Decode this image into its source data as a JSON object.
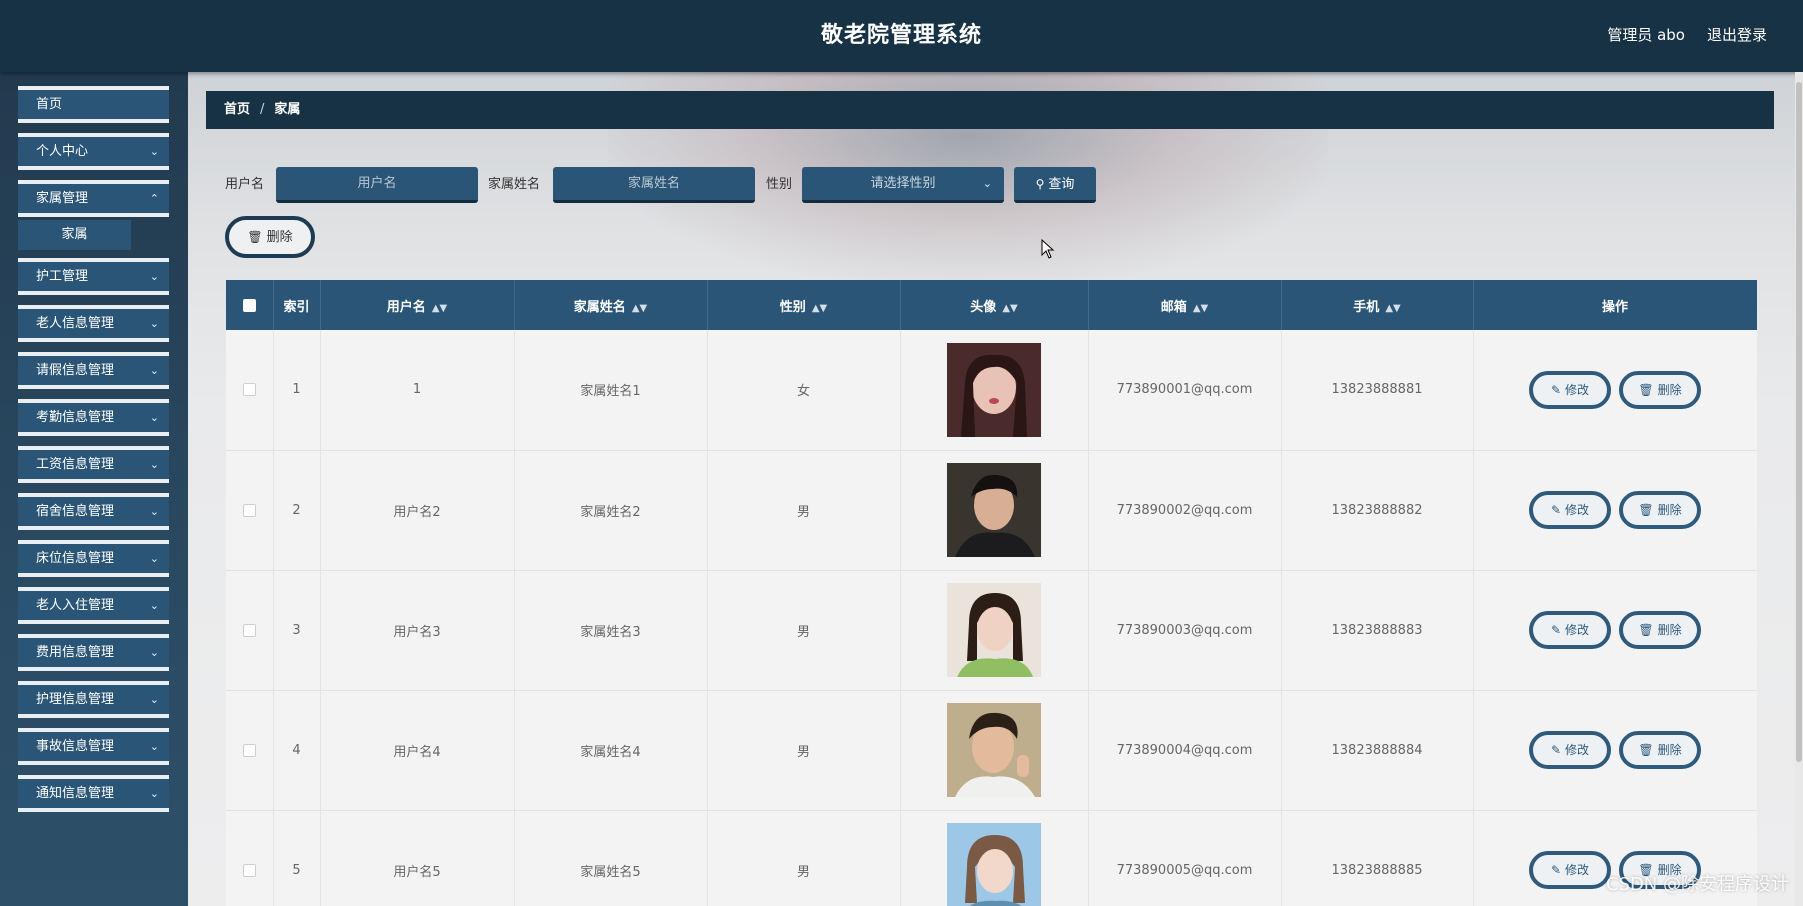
{
  "header": {
    "title": "敬老院管理系统",
    "user": "管理员 abo",
    "logout": "退出登录"
  },
  "sidebar": {
    "items": [
      {
        "label": "首页",
        "has_chevron": false
      },
      {
        "label": "个人中心",
        "has_chevron": true
      },
      {
        "label": "家属管理",
        "has_chevron": true
      },
      {
        "label": "护工管理",
        "has_chevron": true
      },
      {
        "label": "老人信息管理",
        "has_chevron": true
      },
      {
        "label": "请假信息管理",
        "has_chevron": true
      },
      {
        "label": "考勤信息管理",
        "has_chevron": true
      },
      {
        "label": "工资信息管理",
        "has_chevron": true
      },
      {
        "label": "宿舍信息管理",
        "has_chevron": true
      },
      {
        "label": "床位信息管理",
        "has_chevron": true
      },
      {
        "label": "老人入住管理",
        "has_chevron": true
      },
      {
        "label": "费用信息管理",
        "has_chevron": true
      },
      {
        "label": "护理信息管理",
        "has_chevron": true
      },
      {
        "label": "事故信息管理",
        "has_chevron": true
      },
      {
        "label": "通知信息管理",
        "has_chevron": true
      }
    ],
    "submenu_label": "家属"
  },
  "breadcrumb": {
    "home": "首页",
    "separator": "/",
    "current": "家属"
  },
  "search": {
    "username_label": "用户名",
    "username_placeholder": "用户名",
    "name_label": "家属姓名",
    "name_placeholder": "家属姓名",
    "gender_label": "性别",
    "gender_placeholder": "请选择性别",
    "query_button": "查询"
  },
  "toolbar": {
    "delete_button": "删除"
  },
  "table": {
    "columns": [
      "索引",
      "用户名",
      "家属姓名",
      "性别",
      "头像",
      "邮箱",
      "手机",
      "操作"
    ],
    "rows": [
      {
        "index": "1",
        "username": "1",
        "name": "家属姓名1",
        "gender": "女",
        "email": "773890001@qq.com",
        "phone": "13823888881"
      },
      {
        "index": "2",
        "username": "用户名2",
        "name": "家属姓名2",
        "gender": "男",
        "email": "773890002@qq.com",
        "phone": "13823888882"
      },
      {
        "index": "3",
        "username": "用户名3",
        "name": "家属姓名3",
        "gender": "男",
        "email": "773890003@qq.com",
        "phone": "13823888883"
      },
      {
        "index": "4",
        "username": "用户名4",
        "name": "家属姓名4",
        "gender": "男",
        "email": "773890004@qq.com",
        "phone": "13823888884"
      },
      {
        "index": "5",
        "username": "用户名5",
        "name": "家属姓名5",
        "gender": "男",
        "email": "773890005@qq.com",
        "phone": "13823888885"
      }
    ],
    "edit_label": "修改",
    "delete_label": "删除"
  },
  "watermark": "CSDN @除安程序设计",
  "colors": {
    "header_bg": "#173244",
    "accent": "#2a5577",
    "button_border": "#2f5a7c"
  }
}
